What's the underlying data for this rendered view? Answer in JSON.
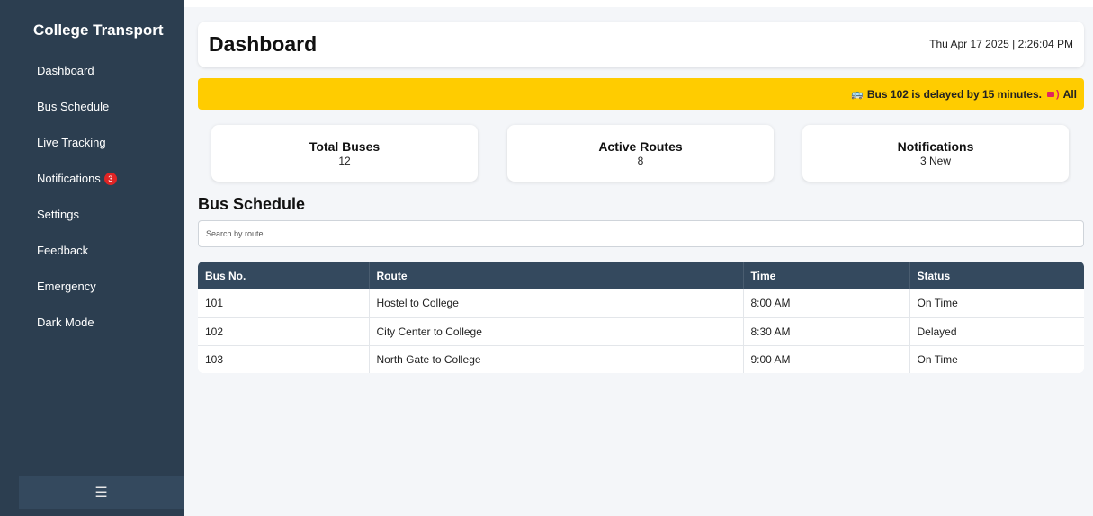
{
  "sidebar": {
    "title": "College Transport",
    "items": [
      {
        "label": "Dashboard"
      },
      {
        "label": "Bus Schedule"
      },
      {
        "label": "Live Tracking"
      },
      {
        "label": "Notifications",
        "badge": "3"
      },
      {
        "label": "Settings"
      },
      {
        "label": "Feedback"
      },
      {
        "label": "Emergency"
      },
      {
        "label": "Dark Mode"
      }
    ],
    "toggle_icon": "☰"
  },
  "header": {
    "title": "Dashboard",
    "datetime": "Thu Apr 17 2025 | 2:26:04 PM"
  },
  "alert": {
    "message": "Bus 102 is delayed by 15 minutes.",
    "suffix": "All",
    "color": "#ffcc00"
  },
  "stats": [
    {
      "label": "Total Buses",
      "value": "12"
    },
    {
      "label": "Active Routes",
      "value": "8"
    },
    {
      "label": "Notifications",
      "value": "3 New"
    }
  ],
  "schedule": {
    "title": "Bus Schedule",
    "search_placeholder": "Search by route...",
    "columns": [
      "Bus No.",
      "Route",
      "Time",
      "Status"
    ],
    "rows": [
      [
        "101",
        "Hostel to College",
        "8:00 AM",
        "On Time"
      ],
      [
        "102",
        "City Center to College",
        "8:30 AM",
        "Delayed"
      ],
      [
        "103",
        "North Gate to College",
        "9:00 AM",
        "On Time"
      ]
    ]
  },
  "colors": {
    "sidebar_bg": "#2c3e50",
    "table_header_bg": "#34495e",
    "badge_red": "#e02424",
    "page_bg": "#f4f6f9"
  }
}
